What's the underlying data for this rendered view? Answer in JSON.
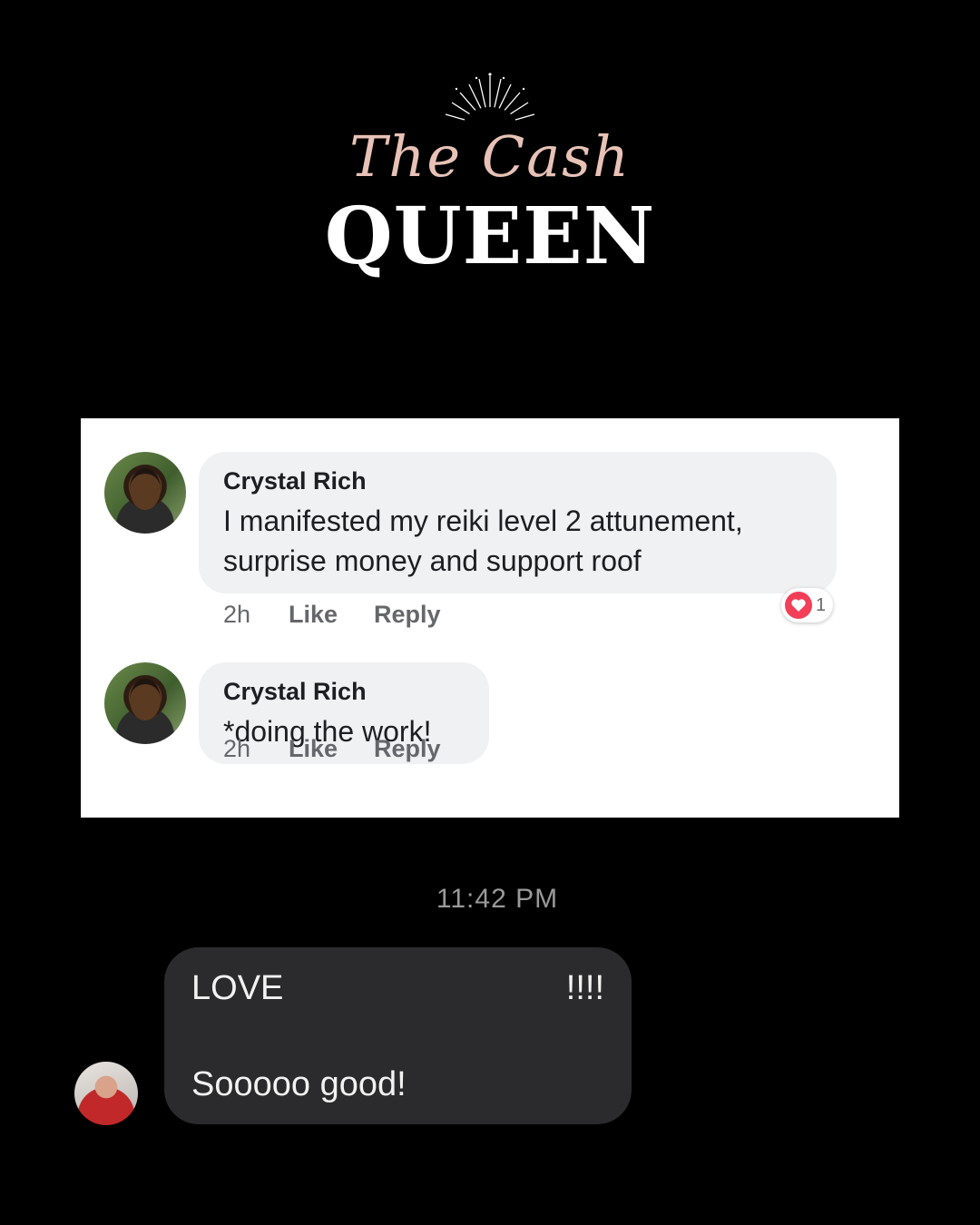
{
  "brand": {
    "script_text": "The Cash",
    "wordmark": "QUEEN",
    "colors": {
      "script": "#e8c2b6",
      "wordmark": "#ffffff",
      "background": "#000000"
    }
  },
  "comments": [
    {
      "author": "Crystal Rich",
      "text": "I manifested my reiki level 2 attunement, surprise money and support roof",
      "time": "2h",
      "like_label": "Like",
      "reply_label": "Reply",
      "reaction": {
        "icon": "heart-icon",
        "count": "1",
        "color": "#f33e58"
      }
    },
    {
      "author": "Crystal Rich",
      "text": "*doing the work!",
      "time": "2h",
      "like_label": "Like",
      "reply_label": "Reply"
    }
  ],
  "chat": {
    "timestamp": "11:42 PM",
    "message_line1_left": "LOVE",
    "message_line1_right": "!!!!",
    "message_line2": "Sooooo good!"
  }
}
